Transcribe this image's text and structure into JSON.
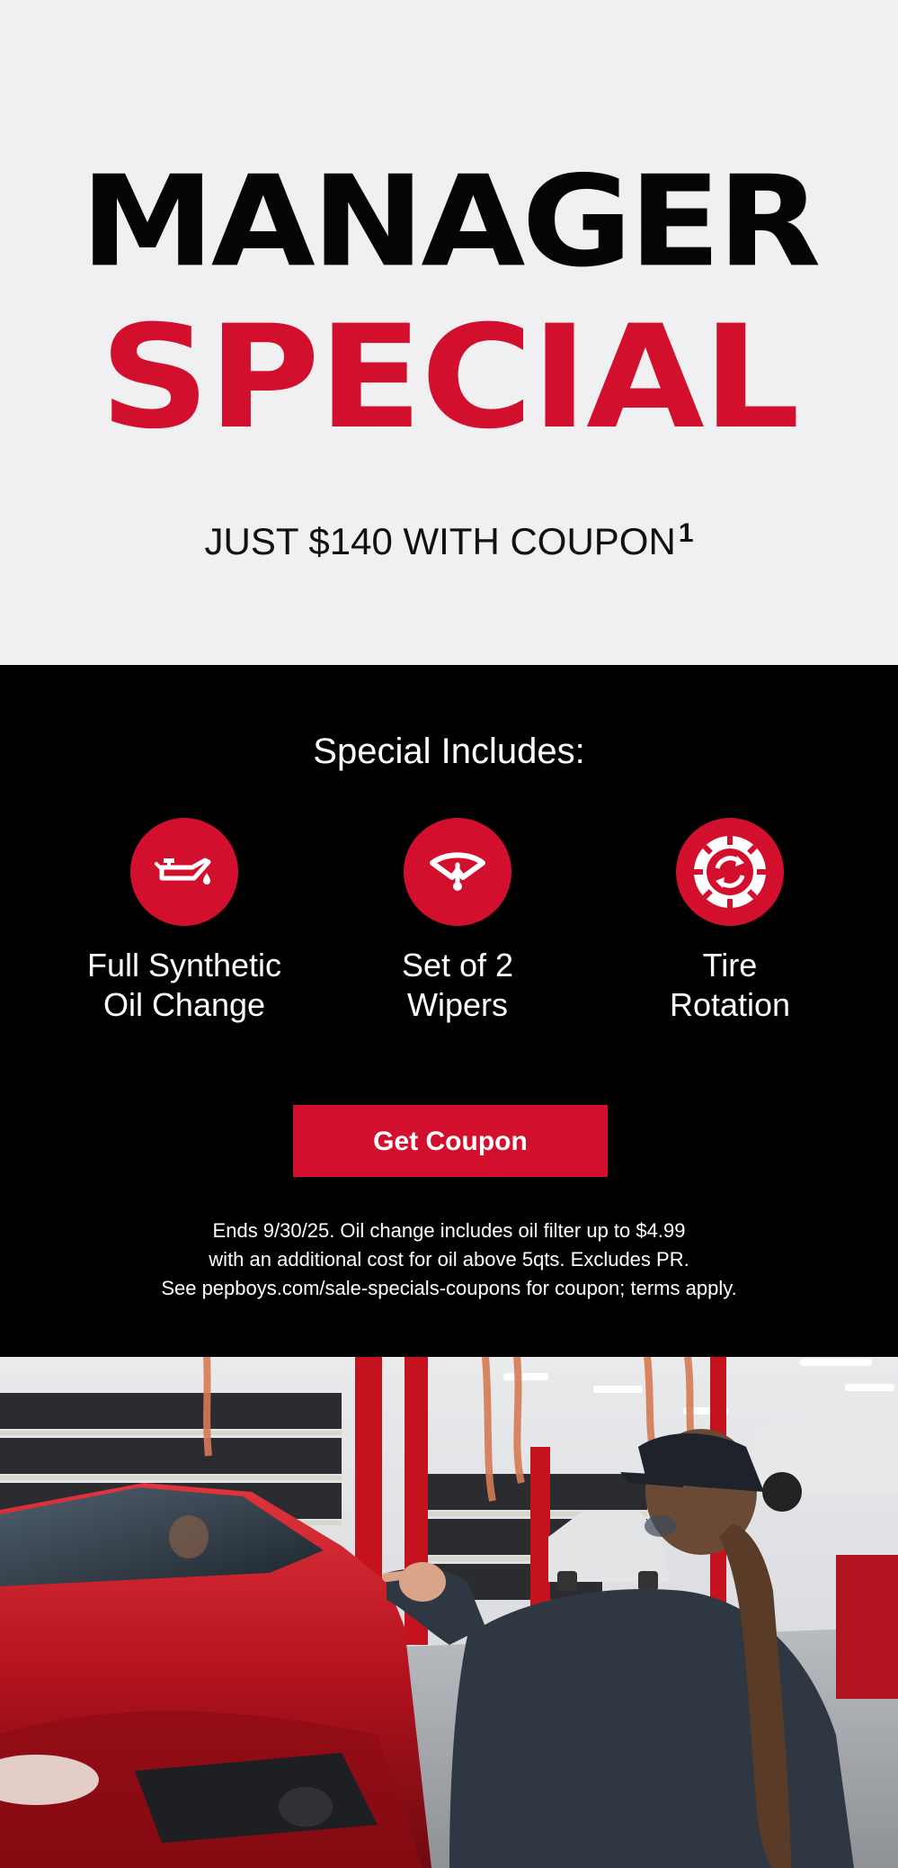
{
  "hero": {
    "line1": "MANAGER",
    "line2": "SPECIAL",
    "subtitle": "JUST $140 WITH COUPON",
    "footnote_marker": "1"
  },
  "includes": {
    "title": "Special Includes:",
    "items": [
      {
        "icon": "oil-can-icon",
        "label": "Full Synthetic\nOil Change"
      },
      {
        "icon": "wiper-icon",
        "label": "Set of 2\nWipers"
      },
      {
        "icon": "tire-rotation-icon",
        "label": "Tire\nRotation"
      }
    ]
  },
  "cta": {
    "label": "Get Coupon"
  },
  "disclaimer": {
    "line1": "Ends 9/30/25. Oil change includes oil filter up to $4.99",
    "line2": "with an additional cost for oil above 5qts. Excludes PR.",
    "line3": "See pepboys.com/sale-specials-coupons for coupon; terms apply."
  },
  "photo": {
    "description": "technician-pointing-at-red-car-in-service-bay"
  },
  "colors": {
    "brand_red": "#d2102e",
    "hero_background": "#f0f0f2",
    "dark_background": "#000000",
    "heading_black": "#050505"
  }
}
